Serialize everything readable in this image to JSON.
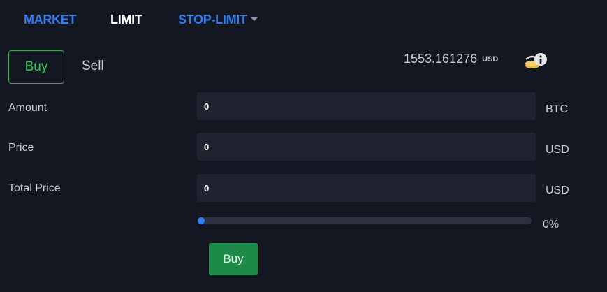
{
  "tabs": {
    "market": "MARKET",
    "limit": "LIMIT",
    "stop_limit": "STOP-LIMIT"
  },
  "side": {
    "buy": "Buy",
    "sell": "Sell",
    "selected": "Buy"
  },
  "balance": {
    "amount": "1553.161276",
    "currency": "USD",
    "icon": "wallet-info-icon"
  },
  "form": {
    "amount": {
      "label": "Amount",
      "value": "0",
      "unit": "BTC"
    },
    "price": {
      "label": "Price",
      "value": "0",
      "unit": "USD"
    },
    "total": {
      "label": "Total Price",
      "value": "0",
      "unit": "USD"
    }
  },
  "slider": {
    "percent": 0,
    "percent_label": "0%"
  },
  "submit_label": "Buy",
  "colors": {
    "background": "#131722",
    "accent_blue": "#2f7df6",
    "buy_green": "#2ab04f",
    "submit_green": "#1e8a4a",
    "field_bg": "#1f2330"
  }
}
